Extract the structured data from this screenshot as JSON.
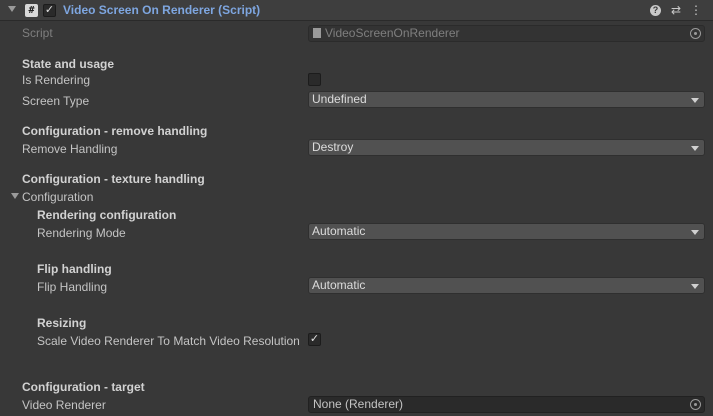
{
  "component": {
    "title": "Video Screen On Renderer (Script)",
    "badge": "#",
    "enabled_mark": "✓",
    "icons": {
      "help": "?",
      "presets": "⇄",
      "menu": "⋮"
    }
  },
  "fields": {
    "script": {
      "label": "Script",
      "value": "VideoScreenOnRenderer"
    },
    "state_header": "State and usage",
    "is_rendering": {
      "label": "Is Rendering",
      "checked": false
    },
    "screen_type": {
      "label": "Screen Type",
      "value": "Undefined"
    },
    "remove_header": "Configuration - remove handling",
    "remove_handling": {
      "label": "Remove Handling",
      "value": "Destroy"
    },
    "texture_header": "Configuration - texture handling",
    "configuration_foldout": "Configuration",
    "rendering_config_header": "Rendering configuration",
    "rendering_mode": {
      "label": "Rendering Mode",
      "value": "Automatic"
    },
    "flip_header": "Flip handling",
    "flip_handling": {
      "label": "Flip Handling",
      "value": "Automatic"
    },
    "resizing_header": "Resizing",
    "scale_renderer": {
      "label": "Scale Video Renderer To Match Video Resolution",
      "checked": true,
      "mark": "✓"
    },
    "target_header": "Configuration - target",
    "video_renderer": {
      "label": "Video Renderer",
      "value": "None (Renderer)"
    }
  }
}
